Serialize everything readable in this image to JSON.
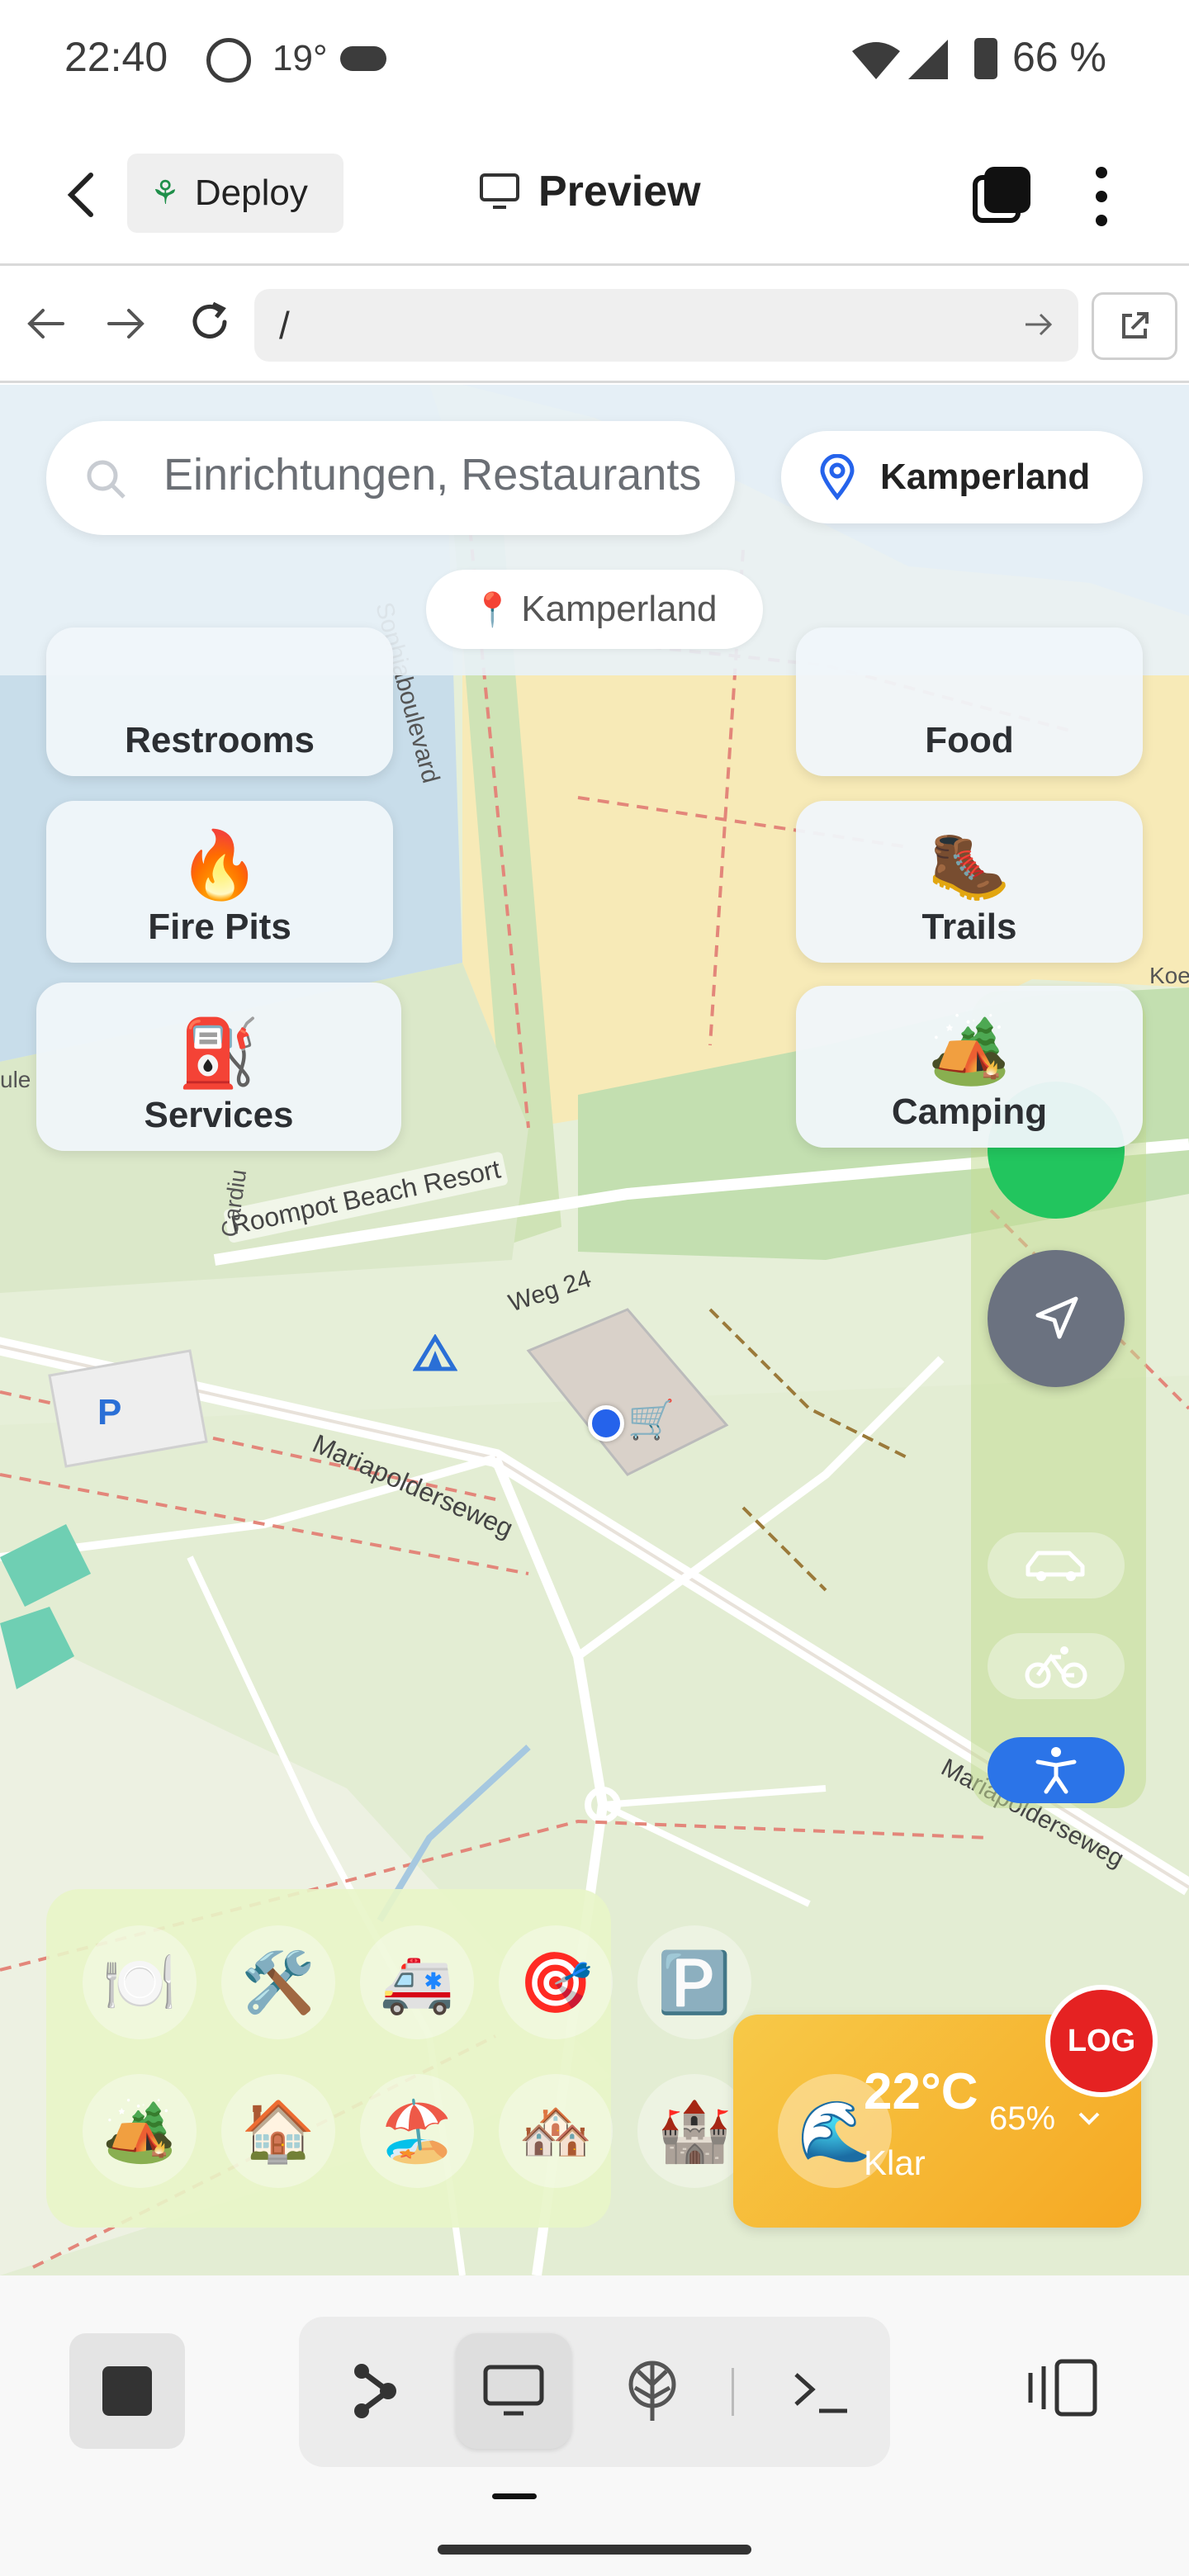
{
  "status": {
    "time": "22:40",
    "temperature": "19°",
    "battery": "66 %"
  },
  "appbar": {
    "deploy_label": "Deploy",
    "preview_label": "Preview"
  },
  "urlbar": {
    "url": "/"
  },
  "search": {
    "placeholder": "Einrichtungen, Restaurants",
    "location_button": "Kamperland",
    "location_chip": "Kamperland"
  },
  "categories": [
    {
      "label": "Restrooms",
      "icon": "restroom-icon",
      "emoji": "🚻"
    },
    {
      "label": "Food",
      "icon": "plate-icon",
      "emoji": "🍽️"
    },
    {
      "label": "Fire Pits",
      "icon": "fire-icon",
      "emoji": "🔥"
    },
    {
      "label": "Trails",
      "icon": "hiking-boot-icon",
      "emoji": "🥾"
    },
    {
      "label": "Services",
      "icon": "fuel-pump-icon",
      "emoji": "⛽"
    },
    {
      "label": "Camping",
      "icon": "camping-icon",
      "emoji": "🏕️"
    }
  ],
  "map_labels": {
    "sophiaboulevard": "Sophiaboulevard",
    "roompot": "Roompot Beach Resort",
    "weg24": "Weg 24",
    "mariapolderseweg": "Mariapolderseweg",
    "mariapolderseweg2": "Mariapolderseweg",
    "cardiu": "Cardiu",
    "koe": "Koe",
    "ule": "ule",
    "parking": "P"
  },
  "tray": [
    {
      "name": "plate-icon",
      "emoji": "🍽️"
    },
    {
      "name": "tools-icon",
      "emoji": "🛠️"
    },
    {
      "name": "ambulance-icon",
      "emoji": "🚑"
    },
    {
      "name": "target-icon",
      "emoji": "🎯"
    },
    {
      "name": "parking-icon",
      "emoji": "🅿️"
    },
    {
      "name": "camping-icon",
      "emoji": "🏕️"
    },
    {
      "name": "house-icon",
      "emoji": "🏠"
    },
    {
      "name": "beach-umbrella-icon",
      "emoji": "🏖️"
    },
    {
      "name": "houses-icon",
      "emoji": "🏘️"
    },
    {
      "name": "castle-icon",
      "emoji": "🏰"
    },
    {
      "name": "wave-icon",
      "emoji": "🌊"
    }
  ],
  "weather": {
    "temperature": "22°C",
    "humidity": "65%",
    "condition": "Klar"
  },
  "log_button": "LOG",
  "colors": {
    "accent": "#2563eb",
    "go_green": "#22c55e",
    "nav_grey": "#6b7280",
    "access_blue": "#2b74e8",
    "weather": "#f7b731",
    "log_red": "#e52222"
  }
}
